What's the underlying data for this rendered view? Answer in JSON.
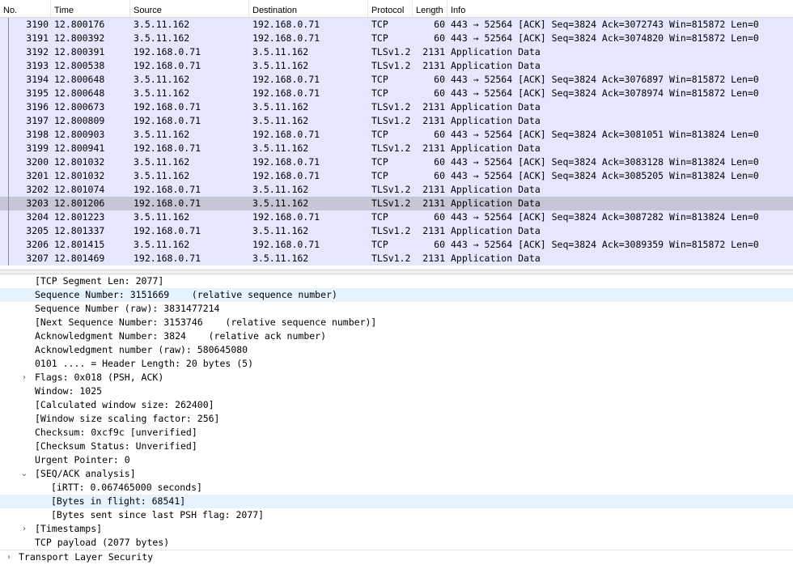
{
  "columns": [
    "No.",
    "Time",
    "Source",
    "Destination",
    "Protocol",
    "Length",
    "Info"
  ],
  "packets": [
    {
      "no": "3190",
      "time": "12.800176",
      "src": "3.5.11.162",
      "dst": "192.168.0.71",
      "proto": "TCP",
      "len": "60",
      "info": "443 → 52564 [ACK] Seq=3824 Ack=3072743 Win=815872 Len=0"
    },
    {
      "no": "3191",
      "time": "12.800392",
      "src": "3.5.11.162",
      "dst": "192.168.0.71",
      "proto": "TCP",
      "len": "60",
      "info": "443 → 52564 [ACK] Seq=3824 Ack=3074820 Win=815872 Len=0"
    },
    {
      "no": "3192",
      "time": "12.800391",
      "src": "192.168.0.71",
      "dst": "3.5.11.162",
      "proto": "TLSv1.2",
      "len": "2131",
      "info": "Application Data"
    },
    {
      "no": "3193",
      "time": "12.800538",
      "src": "192.168.0.71",
      "dst": "3.5.11.162",
      "proto": "TLSv1.2",
      "len": "2131",
      "info": "Application Data"
    },
    {
      "no": "3194",
      "time": "12.800648",
      "src": "3.5.11.162",
      "dst": "192.168.0.71",
      "proto": "TCP",
      "len": "60",
      "info": "443 → 52564 [ACK] Seq=3824 Ack=3076897 Win=815872 Len=0"
    },
    {
      "no": "3195",
      "time": "12.800648",
      "src": "3.5.11.162",
      "dst": "192.168.0.71",
      "proto": "TCP",
      "len": "60",
      "info": "443 → 52564 [ACK] Seq=3824 Ack=3078974 Win=815872 Len=0"
    },
    {
      "no": "3196",
      "time": "12.800673",
      "src": "192.168.0.71",
      "dst": "3.5.11.162",
      "proto": "TLSv1.2",
      "len": "2131",
      "info": "Application Data"
    },
    {
      "no": "3197",
      "time": "12.800809",
      "src": "192.168.0.71",
      "dst": "3.5.11.162",
      "proto": "TLSv1.2",
      "len": "2131",
      "info": "Application Data"
    },
    {
      "no": "3198",
      "time": "12.800903",
      "src": "3.5.11.162",
      "dst": "192.168.0.71",
      "proto": "TCP",
      "len": "60",
      "info": "443 → 52564 [ACK] Seq=3824 Ack=3081051 Win=813824 Len=0"
    },
    {
      "no": "3199",
      "time": "12.800941",
      "src": "192.168.0.71",
      "dst": "3.5.11.162",
      "proto": "TLSv1.2",
      "len": "2131",
      "info": "Application Data"
    },
    {
      "no": "3200",
      "time": "12.801032",
      "src": "3.5.11.162",
      "dst": "192.168.0.71",
      "proto": "TCP",
      "len": "60",
      "info": "443 → 52564 [ACK] Seq=3824 Ack=3083128 Win=813824 Len=0"
    },
    {
      "no": "3201",
      "time": "12.801032",
      "src": "3.5.11.162",
      "dst": "192.168.0.71",
      "proto": "TCP",
      "len": "60",
      "info": "443 → 52564 [ACK] Seq=3824 Ack=3085205 Win=813824 Len=0"
    },
    {
      "no": "3202",
      "time": "12.801074",
      "src": "192.168.0.71",
      "dst": "3.5.11.162",
      "proto": "TLSv1.2",
      "len": "2131",
      "info": "Application Data"
    },
    {
      "no": "3203",
      "time": "12.801206",
      "src": "192.168.0.71",
      "dst": "3.5.11.162",
      "proto": "TLSv1.2",
      "len": "2131",
      "info": "Application Data",
      "selected": true
    },
    {
      "no": "3204",
      "time": "12.801223",
      "src": "3.5.11.162",
      "dst": "192.168.0.71",
      "proto": "TCP",
      "len": "60",
      "info": "443 → 52564 [ACK] Seq=3824 Ack=3087282 Win=813824 Len=0"
    },
    {
      "no": "3205",
      "time": "12.801337",
      "src": "192.168.0.71",
      "dst": "3.5.11.162",
      "proto": "TLSv1.2",
      "len": "2131",
      "info": "Application Data"
    },
    {
      "no": "3206",
      "time": "12.801415",
      "src": "3.5.11.162",
      "dst": "192.168.0.71",
      "proto": "TCP",
      "len": "60",
      "info": "443 → 52564 [ACK] Seq=3824 Ack=3089359 Win=815872 Len=0"
    },
    {
      "no": "3207",
      "time": "12.801469",
      "src": "192.168.0.71",
      "dst": "3.5.11.162",
      "proto": "TLSv1.2",
      "len": "2131",
      "info": "Application Data"
    }
  ],
  "details": [
    {
      "level": 1,
      "text": "[TCP Segment Len: 2077]"
    },
    {
      "level": 1,
      "text": "Sequence Number: 3151669    (relative sequence number)",
      "highlight": true
    },
    {
      "level": 1,
      "text": "Sequence Number (raw): 3831477214"
    },
    {
      "level": 1,
      "text": "[Next Sequence Number: 3153746    (relative sequence number)]"
    },
    {
      "level": 1,
      "text": "Acknowledgment Number: 3824    (relative ack number)"
    },
    {
      "level": 1,
      "text": "Acknowledgment number (raw): 580645080"
    },
    {
      "level": 1,
      "text": "0101 .... = Header Length: 20 bytes (5)"
    },
    {
      "level": 1,
      "text": "Flags: 0x018 (PSH, ACK)",
      "expander": "collapsed"
    },
    {
      "level": 1,
      "text": "Window: 1025"
    },
    {
      "level": 1,
      "text": "[Calculated window size: 262400]"
    },
    {
      "level": 1,
      "text": "[Window size scaling factor: 256]"
    },
    {
      "level": 1,
      "text": "Checksum: 0xcf9c [unverified]"
    },
    {
      "level": 1,
      "text": "[Checksum Status: Unverified]"
    },
    {
      "level": 1,
      "text": "Urgent Pointer: 0"
    },
    {
      "level": 1,
      "text": "[SEQ/ACK analysis]",
      "expander": "expanded"
    },
    {
      "level": 2,
      "text": "[iRTT: 0.067465000 seconds]"
    },
    {
      "level": 2,
      "text": "[Bytes in flight: 68541]",
      "highlight": true
    },
    {
      "level": 2,
      "text": "[Bytes sent since last PSH flag: 2077]"
    },
    {
      "level": 1,
      "text": "[Timestamps]",
      "expander": "collapsed"
    },
    {
      "level": 1,
      "text": "TCP payload (2077 bytes)"
    },
    {
      "level": 0,
      "text": "Transport Layer Security",
      "expander": "collapsed"
    }
  ]
}
